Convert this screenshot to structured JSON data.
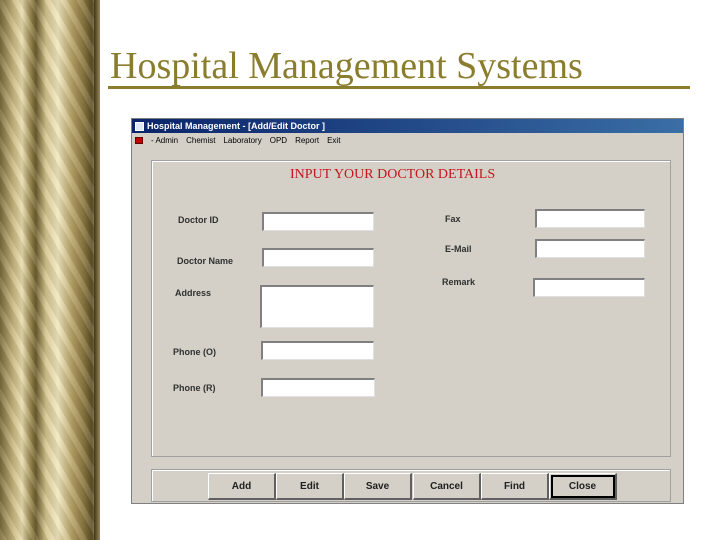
{
  "slide": {
    "title": "Hospital Management Systems"
  },
  "window": {
    "title": "Hospital Management - [Add/Edit Doctor ]",
    "menu": [
      "- Admin",
      "Chemist",
      "Laboratory",
      "OPD",
      "Report",
      "Exit"
    ]
  },
  "form": {
    "heading": "INPUT YOUR DOCTOR DETAILS",
    "labels": {
      "doctor_id": "Doctor ID",
      "doctor_name": "Doctor Name",
      "address": "Address",
      "phone_o": "Phone (O)",
      "phone_r": "Phone (R)",
      "fax": "Fax",
      "email": "E-Mail",
      "remark": "Remark"
    },
    "values": {
      "doctor_id": "",
      "doctor_name": "",
      "address": "",
      "phone_o": "",
      "phone_r": "",
      "fax": "",
      "email": "",
      "remark": ""
    }
  },
  "buttons": {
    "add": "Add",
    "edit": "Edit",
    "save": "Save",
    "cancel": "Cancel",
    "find": "Find",
    "close": "Close"
  }
}
